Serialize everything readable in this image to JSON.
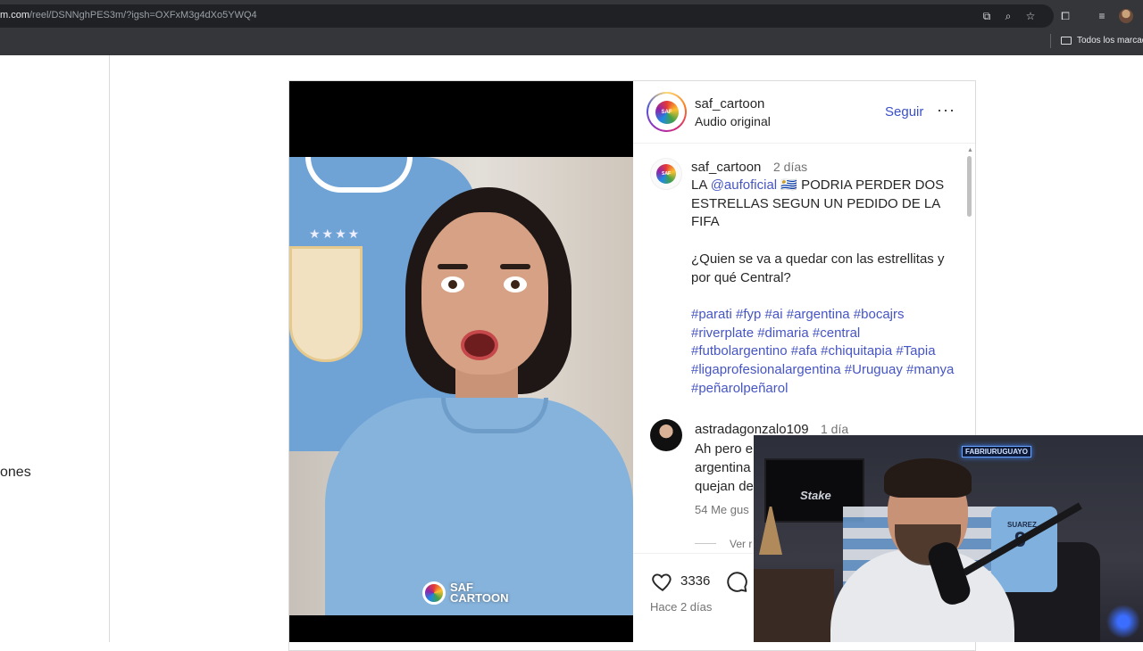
{
  "browser": {
    "url_host": "m.com",
    "url_path": "/reel/DSNNghPES3m/?igsh=OXFxM3g4dXo5YWQ4",
    "bookmarks_folder": "Todos los marcad"
  },
  "left_nav": {
    "partial_label": "ones"
  },
  "post": {
    "author": "saf_cartoon",
    "audio": "Audio original",
    "follow_label": "Seguir",
    "more_label": "···",
    "caption": {
      "user": "saf_cartoon",
      "time": "2 días",
      "prefix": "LA ",
      "mention": "@aufoficial",
      "body": " 🇺🇾 PODRIA PERDER DOS ESTRELLAS SEGUN UN PEDIDO DE LA FIFA\n\n¿Quien se va a quedar con las estrellitas y por qué Central?\n\n",
      "hashtags": "#parati #fyp #ai #argentina #bocajrs #riverplate #dimaria #central #futbolargentino #afa #chiquitapia #Tapia #ligaprofesionalargentina #Uruguay #manya #peñarolpeñarol"
    },
    "comment": {
      "user": "astradagonzalo109",
      "time": "1 día",
      "text": "Ah pero e\nargentina\nquejan de",
      "likes": "54 Me gus",
      "view_replies": "Ver r"
    },
    "likes_count": "3336",
    "date": "Hace 2 días",
    "watermark_line1": "SAF",
    "watermark_line2": "CARTOON"
  },
  "webcam": {
    "sign": "FABRIURUGUAYO",
    "tv_logo": "Stake",
    "jersey_name": "SUAREZ",
    "jersey_number": "9"
  },
  "colors": {
    "link": "#4655c4",
    "follow": "#3a50c8",
    "text": "#262626",
    "muted": "#737373"
  }
}
